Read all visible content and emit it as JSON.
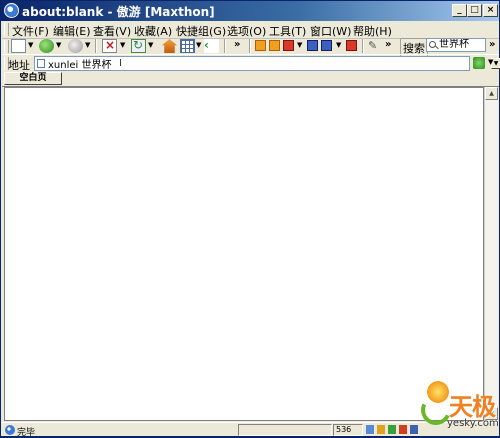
{
  "window": {
    "title": "about:blank - 傲游 [Maxthon]",
    "caption_buttons": [
      "_",
      "□",
      "×"
    ]
  },
  "menubar": {
    "items": [
      "文件(F)",
      "编辑(E)",
      "查看(V)",
      "收藏(A)",
      "快捷组(G)",
      "选项(O)",
      "工具(T)",
      "窗口(W)",
      "帮助(H)"
    ]
  },
  "toolbar": {
    "icons": [
      "new-page-icon",
      "back-icon",
      "forward-icon",
      "stop-icon",
      "refresh-icon",
      "home-icon",
      "grid-icon",
      "green-arrow-icon",
      "orange-icon",
      "orange-icon-2",
      "red-close-icon",
      "blue-icon",
      "blue-icon-2",
      "close-red-icon",
      "tool-icon"
    ],
    "more": "»",
    "search_label": "搜索",
    "search_value": "世界杯"
  },
  "addressbar": {
    "label": "地址",
    "value": "xunlei 世界杯"
  },
  "tabs": [
    {
      "label": "空白页"
    }
  ],
  "statusbar": {
    "text": "完毕",
    "counter": "536"
  },
  "watermark": {
    "brand": "天极",
    "site": "yesky.com"
  },
  "colors": {
    "title_bar_start": "#0a246a",
    "title_bar_end": "#a6caf0",
    "chrome": "#ece9d8",
    "content": "#ffffff"
  }
}
